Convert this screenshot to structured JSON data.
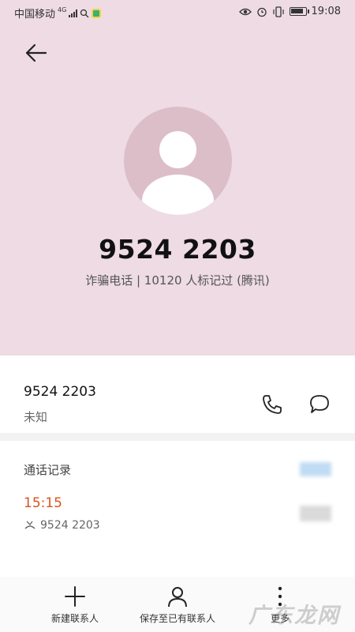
{
  "status_bar": {
    "carrier": "中国移动",
    "network": "4G",
    "time": "19:08"
  },
  "header": {
    "back_icon": "arrow-left-icon"
  },
  "caller": {
    "avatar_icon": "person-icon",
    "number": "9524 2203",
    "tag_info": "诈骗电话 | 10120 人标记过 (腾讯)"
  },
  "contact_row": {
    "number": "9524 2203",
    "location": "未知",
    "call_icon": "phone-icon",
    "message_icon": "message-icon"
  },
  "call_log": {
    "title": "通话记录",
    "entries": [
      {
        "time": "15:15",
        "number": "9524 2203",
        "type_icon": "missed-call-icon"
      }
    ]
  },
  "bottom_bar": {
    "items": [
      {
        "label": "新建联系人",
        "icon": "plus-icon"
      },
      {
        "label": "保存至已有联系人",
        "icon": "person-outline-icon"
      },
      {
        "label": "更多",
        "icon": "more-vertical-icon"
      }
    ]
  },
  "watermark": "广东龙网",
  "colors": {
    "hero_bg": "#eedbe3",
    "avatar_bg": "#dcbec8",
    "time_accent": "#d9531c"
  }
}
